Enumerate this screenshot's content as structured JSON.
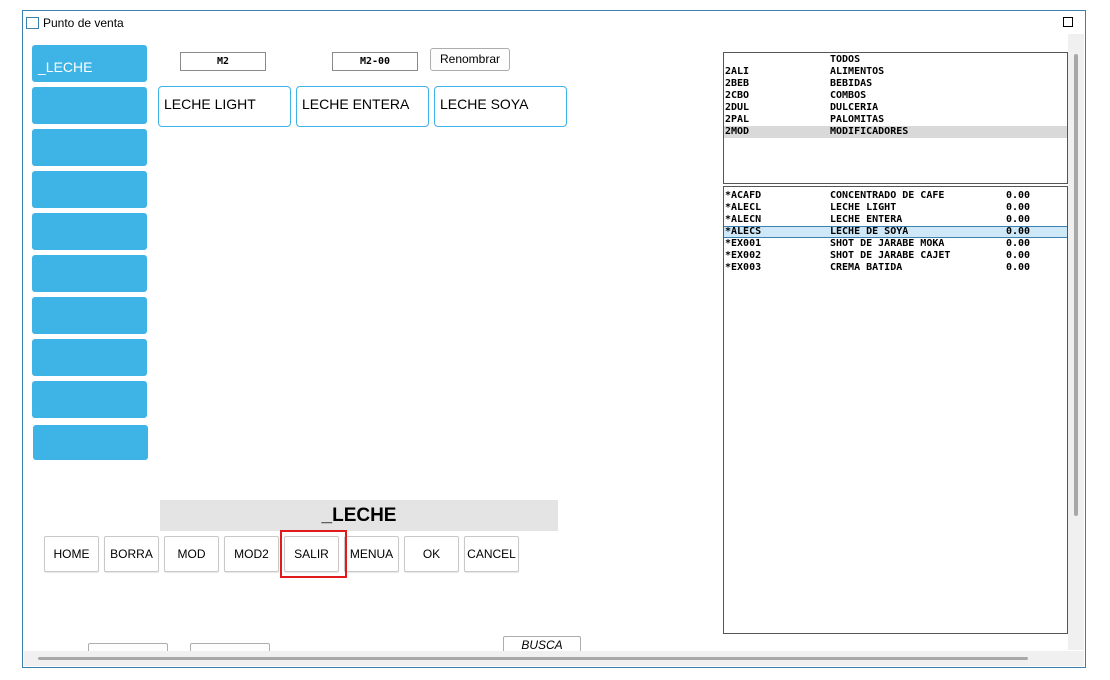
{
  "window": {
    "title": "Punto de venta"
  },
  "categories": [
    {
      "label": "_LECHE"
    },
    {
      "label": ""
    },
    {
      "label": ""
    },
    {
      "label": ""
    },
    {
      "label": ""
    },
    {
      "label": ""
    },
    {
      "label": ""
    },
    {
      "label": ""
    },
    {
      "label": ""
    },
    {
      "label": ""
    }
  ],
  "header": {
    "code1": "M2",
    "code2": "M2-00",
    "rename_label": "Renombrar"
  },
  "products": [
    {
      "label": "LECHE LIGHT"
    },
    {
      "label": "LECHE ENTERA"
    },
    {
      "label": "LECHE SOYA"
    }
  ],
  "current_category": "_LECHE",
  "actions": [
    {
      "label": "HOME"
    },
    {
      "label": "BORRA"
    },
    {
      "label": "MOD"
    },
    {
      "label": "MOD2"
    },
    {
      "label": "SALIR"
    },
    {
      "label": "MENUA"
    },
    {
      "label": "OK"
    },
    {
      "label": "CANCEL"
    }
  ],
  "group_list": [
    {
      "code": "",
      "name": "TODOS"
    },
    {
      "code": "2ALI",
      "name": "ALIMENTOS"
    },
    {
      "code": "2BEB",
      "name": "BEBIDAS"
    },
    {
      "code": "2CBO",
      "name": "COMBOS"
    },
    {
      "code": "2DUL",
      "name": "DULCERIA"
    },
    {
      "code": "2PAL",
      "name": "PALOMITAS"
    },
    {
      "code": "2MOD",
      "name": "MODIFICADORES",
      "selected": true
    }
  ],
  "item_list": [
    {
      "code": "*ACAFD",
      "name": "CONCENTRADO DE CAFE",
      "price": "0.00"
    },
    {
      "code": "*ALECL",
      "name": "LECHE LIGHT",
      "price": "0.00"
    },
    {
      "code": "*ALECN",
      "name": "LECHE ENTERA",
      "price": "0.00"
    },
    {
      "code": "*ALECS",
      "name": "LECHE DE SOYA",
      "price": "0.00",
      "selected": true
    },
    {
      "code": "*EX001",
      "name": "SHOT DE JARABE MOKA",
      "price": "0.00"
    },
    {
      "code": "*EX002",
      "name": "SHOT DE JARABE CAJET",
      "price": "0.00"
    },
    {
      "code": "*EX003",
      "name": "CREMA BATIDA",
      "price": "0.00"
    }
  ],
  "bottom": {
    "busca_label": "BUSCA PROD",
    "btn1_label": "",
    "btn2_label": ""
  },
  "colors": {
    "category_button": "#3eb3e6",
    "highlight_border": "#e11b1b",
    "window_border": "#3c7fb1"
  }
}
